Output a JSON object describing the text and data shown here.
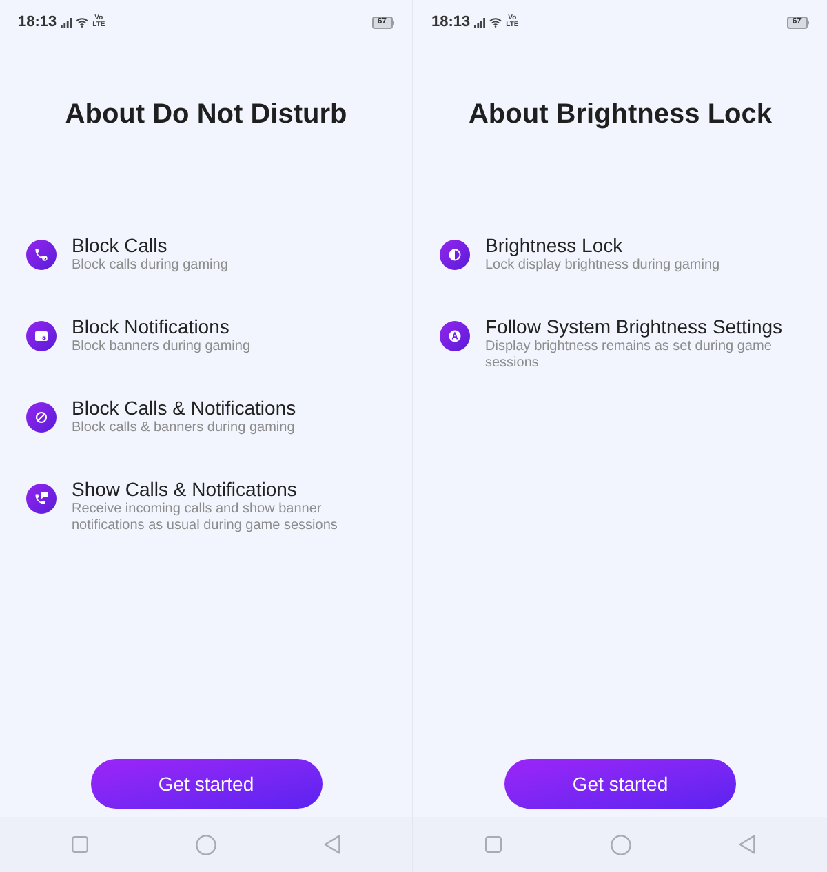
{
  "screens": [
    {
      "status_bar": {
        "time": "18:13",
        "network_top": "Vo",
        "network_bottom": "LTE",
        "battery": "67"
      },
      "title": "About Do Not Disturb",
      "items": [
        {
          "kind": "phone-block",
          "title": "Block Calls",
          "description": "Block calls during gaming"
        },
        {
          "kind": "banner-block",
          "title": "Block Notifications",
          "description": "Block banners during gaming"
        },
        {
          "kind": "block",
          "title": "Block Calls & Notifications",
          "description": "Block calls & banners during gaming"
        },
        {
          "kind": "phone-message",
          "title": "Show Calls & Notifications",
          "description": "Receive incoming calls and show banner notifications as usual during game sessions"
        }
      ],
      "button": "Get started"
    },
    {
      "status_bar": {
        "time": "18:13",
        "network_top": "Vo",
        "network_bottom": "LTE",
        "battery": "67"
      },
      "title": "About Brightness Lock",
      "items": [
        {
          "kind": "contrast",
          "title": "Brightness Lock",
          "description": "Lock display brightness during gaming"
        },
        {
          "kind": "auto",
          "title": "Follow System Brightness Settings",
          "description": "Display brightness remains as set during game sessions"
        }
      ],
      "button": "Get started"
    }
  ]
}
